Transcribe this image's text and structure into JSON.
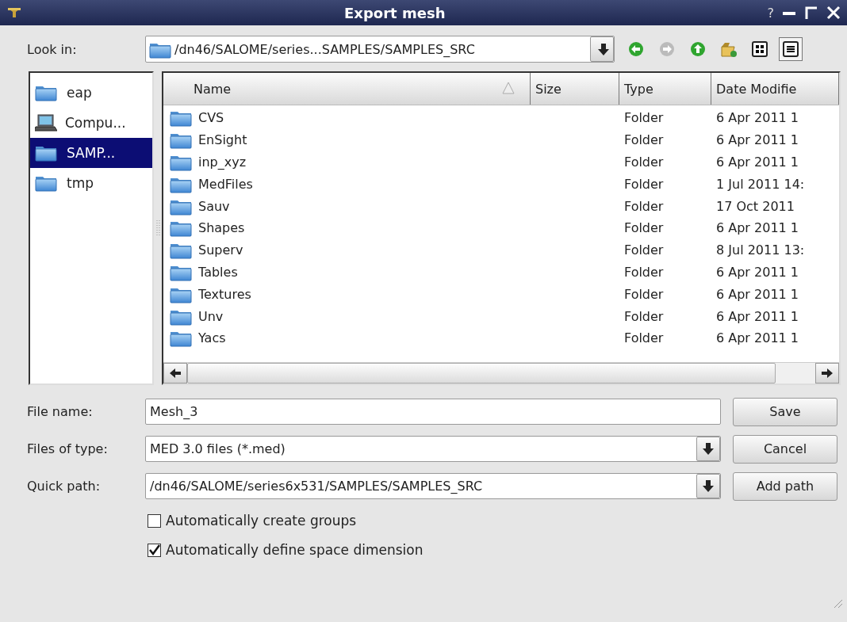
{
  "window": {
    "title": "Export mesh",
    "help": "?"
  },
  "look_in": {
    "label": "Look in:",
    "value": "/dn46/SALOME/series...SAMPLES/SAMPLES_SRC"
  },
  "toolbar": [
    {
      "kind": "back",
      "disabled": false
    },
    {
      "kind": "forward",
      "disabled": true
    },
    {
      "kind": "up",
      "disabled": false
    },
    {
      "kind": "new_folder",
      "disabled": false
    },
    {
      "kind": "list_view",
      "selected": false
    },
    {
      "kind": "detail_view",
      "selected": true
    }
  ],
  "sidebar": {
    "items": [
      {
        "label": "eap",
        "kind": "folder",
        "selected": false
      },
      {
        "label": "Compu...",
        "kind": "computer",
        "selected": false
      },
      {
        "label": "SAMP...",
        "kind": "folder",
        "selected": true
      },
      {
        "label": "tmp",
        "kind": "folder",
        "selected": false
      }
    ]
  },
  "file_list": {
    "columns": [
      {
        "label": "Name",
        "sorted": true
      },
      {
        "label": "Size",
        "sorted": false
      },
      {
        "label": "Type",
        "sorted": false
      },
      {
        "label": "Date Modifie",
        "sorted": false
      }
    ],
    "rows": [
      {
        "name": "CVS",
        "type": "Folder",
        "date": "6 Apr 2011 1"
      },
      {
        "name": "EnSight",
        "type": "Folder",
        "date": "6 Apr 2011 1"
      },
      {
        "name": "inp_xyz",
        "type": "Folder",
        "date": "6 Apr 2011 1"
      },
      {
        "name": "MedFiles",
        "type": "Folder",
        "date": "1 Jul 2011 14:"
      },
      {
        "name": "Sauv",
        "type": "Folder",
        "date": "17 Oct 2011"
      },
      {
        "name": "Shapes",
        "type": "Folder",
        "date": "6 Apr 2011 1"
      },
      {
        "name": "Superv",
        "type": "Folder",
        "date": "8 Jul 2011 13:"
      },
      {
        "name": "Tables",
        "type": "Folder",
        "date": "6 Apr 2011 1"
      },
      {
        "name": "Textures",
        "type": "Folder",
        "date": "6 Apr 2011 1"
      },
      {
        "name": "Unv",
        "type": "Folder",
        "date": "6 Apr 2011 1"
      },
      {
        "name": "Yacs",
        "type": "Folder",
        "date": "6 Apr 2011 1"
      }
    ]
  },
  "form": {
    "fields": [
      {
        "kind": "text",
        "label": "File name:",
        "value": "Mesh_3",
        "button": "Save"
      },
      {
        "kind": "combo",
        "label": "Files of type:",
        "value": "MED 3.0 files (*.med)",
        "button": "Cancel"
      },
      {
        "kind": "combo",
        "label": "Quick path:",
        "value": "/dn46/SALOME/series6x531/SAMPLES/SAMPLES_SRC",
        "button": "Add path"
      }
    ],
    "options": [
      {
        "label": "Automatically create groups",
        "checked": false
      },
      {
        "label": "Automatically define space dimension",
        "checked": true
      }
    ]
  }
}
